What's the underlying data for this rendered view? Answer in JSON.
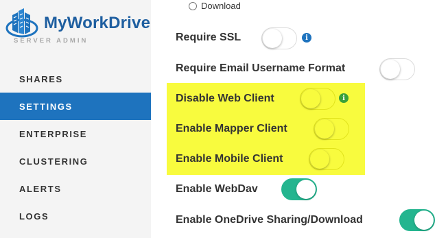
{
  "brand": {
    "title": "MyWorkDrive",
    "subtitle": "SERVER ADMIN",
    "accent": "#1e73be"
  },
  "nav": {
    "items": [
      {
        "label": "SHARES",
        "active": false
      },
      {
        "label": "SETTINGS",
        "active": true
      },
      {
        "label": "ENTERPRISE",
        "active": false
      },
      {
        "label": "CLUSTERING",
        "active": false
      },
      {
        "label": "ALERTS",
        "active": false
      },
      {
        "label": "LOGS",
        "active": false
      }
    ]
  },
  "settings": {
    "download_radio_label": "Download",
    "rows": [
      {
        "label": "Require SSL",
        "on": false,
        "info": "i",
        "info_color": "#1e73be"
      },
      {
        "label": "Require Email Username Format",
        "on": false
      },
      {
        "label": "Disable Web Client",
        "on": false,
        "info": "i",
        "info_color": "#3aa03a",
        "highlighted": true
      },
      {
        "label": "Enable Mapper Client",
        "on": false,
        "highlighted": true
      },
      {
        "label": "Enable Mobile Client",
        "on": false,
        "highlighted": true
      },
      {
        "label": "Enable WebDav",
        "on": true
      },
      {
        "label": "Enable OneDrive Sharing/Download",
        "on": true
      }
    ]
  },
  "colors": {
    "toggle_on": "#24b58f",
    "highlight": "#f8fb3e"
  }
}
